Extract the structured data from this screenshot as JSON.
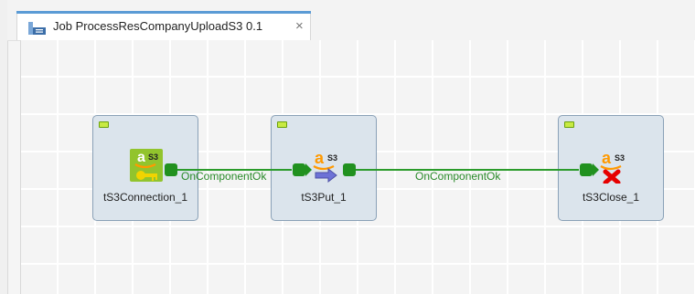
{
  "tab": {
    "title": "Job ProcessResCompanyUploadS3 0.1",
    "close": "×",
    "icon": "job-icon"
  },
  "components": [
    {
      "name": "tS3Connection_1",
      "icon": "s3-connection-icon",
      "status": "ok"
    },
    {
      "name": "tS3Put_1",
      "icon": "s3-put-icon",
      "status": "ok"
    },
    {
      "name": "tS3Close_1",
      "icon": "s3-close-icon",
      "status": "ok"
    }
  ],
  "links": [
    {
      "label": "OnComponentOk",
      "from": "tS3Connection_1",
      "to": "tS3Put_1"
    },
    {
      "label": "OnComponentOk",
      "from": "tS3Put_1",
      "to": "tS3Close_1"
    }
  ],
  "colors": {
    "accent": "#5b9bd5",
    "link": "#21911f",
    "component_bg": "#dbe4ec",
    "status_ok": "#c8ea42"
  }
}
